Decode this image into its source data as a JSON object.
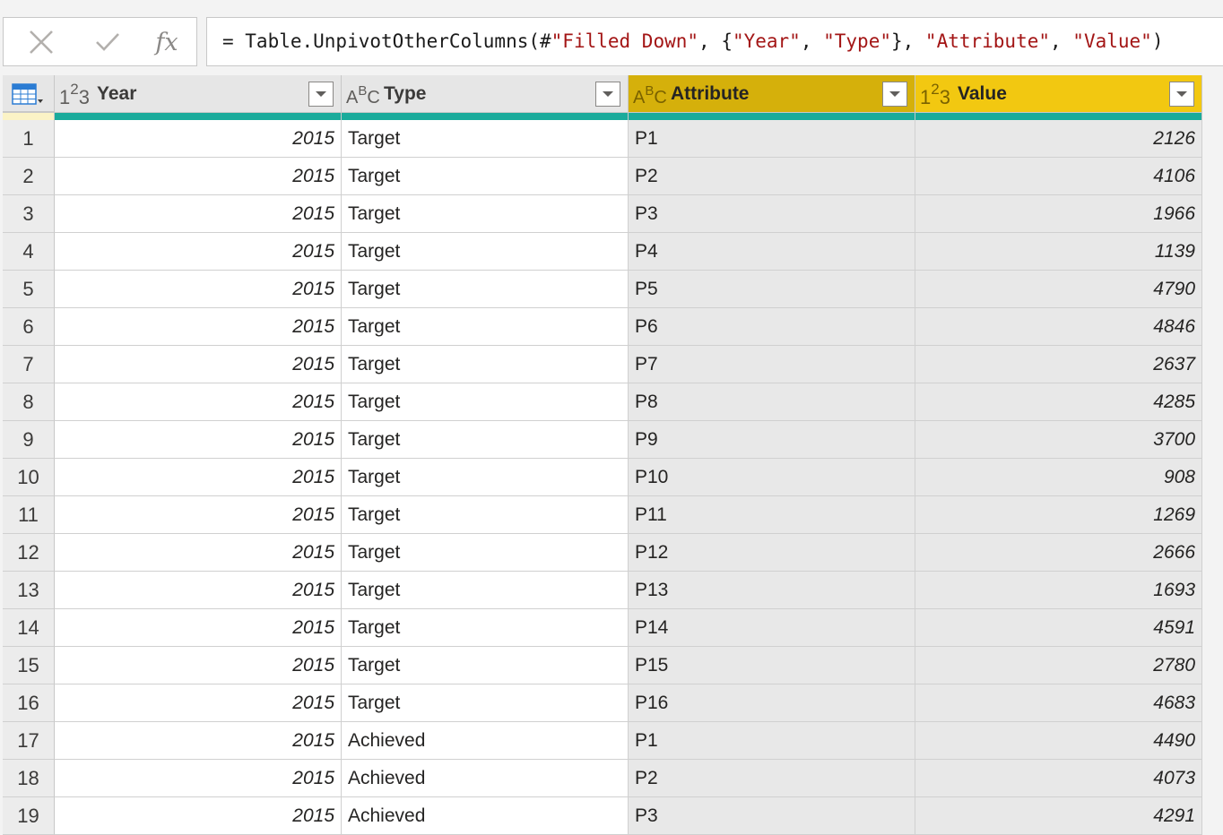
{
  "formula_bar": {
    "prefix": "= Table.UnpivotOtherColumns(#",
    "arg1": "\"Filled Down\"",
    "sep1": ", {",
    "arg2": "\"Year\"",
    "sep2": ", ",
    "arg3": "\"Type\"",
    "sep3": "}, ",
    "arg4": "\"Attribute\"",
    "sep4": ", ",
    "arg5": "\"Value\"",
    "suffix": ")",
    "cancel_icon": "close-icon",
    "commit_icon": "checkmark-icon",
    "fx_label": "fx"
  },
  "columns": [
    {
      "name": "Year",
      "type_icon": "123",
      "selected": false
    },
    {
      "name": "Type",
      "type_icon": "ABC",
      "selected": false
    },
    {
      "name": "Attribute",
      "type_icon": "ABC",
      "selected": true,
      "accent": "#d5b00b"
    },
    {
      "name": "Value",
      "type_icon": "123",
      "selected": true,
      "accent": "#f2c811"
    }
  ],
  "colors": {
    "column_quality": "#1aab9b",
    "selected_header_dark": "#d5b00b",
    "selected_header_light": "#f2c811",
    "formula_string": "#a31515"
  },
  "rows": [
    {
      "idx": "1",
      "year": "2015",
      "type": "Target",
      "attribute": "P1",
      "value": "2126"
    },
    {
      "idx": "2",
      "year": "2015",
      "type": "Target",
      "attribute": "P2",
      "value": "4106"
    },
    {
      "idx": "3",
      "year": "2015",
      "type": "Target",
      "attribute": "P3",
      "value": "1966"
    },
    {
      "idx": "4",
      "year": "2015",
      "type": "Target",
      "attribute": "P4",
      "value": "1139"
    },
    {
      "idx": "5",
      "year": "2015",
      "type": "Target",
      "attribute": "P5",
      "value": "4790"
    },
    {
      "idx": "6",
      "year": "2015",
      "type": "Target",
      "attribute": "P6",
      "value": "4846"
    },
    {
      "idx": "7",
      "year": "2015",
      "type": "Target",
      "attribute": "P7",
      "value": "2637"
    },
    {
      "idx": "8",
      "year": "2015",
      "type": "Target",
      "attribute": "P8",
      "value": "4285"
    },
    {
      "idx": "9",
      "year": "2015",
      "type": "Target",
      "attribute": "P9",
      "value": "3700"
    },
    {
      "idx": "10",
      "year": "2015",
      "type": "Target",
      "attribute": "P10",
      "value": "908"
    },
    {
      "idx": "11",
      "year": "2015",
      "type": "Target",
      "attribute": "P11",
      "value": "1269"
    },
    {
      "idx": "12",
      "year": "2015",
      "type": "Target",
      "attribute": "P12",
      "value": "2666"
    },
    {
      "idx": "13",
      "year": "2015",
      "type": "Target",
      "attribute": "P13",
      "value": "1693"
    },
    {
      "idx": "14",
      "year": "2015",
      "type": "Target",
      "attribute": "P14",
      "value": "4591"
    },
    {
      "idx": "15",
      "year": "2015",
      "type": "Target",
      "attribute": "P15",
      "value": "2780"
    },
    {
      "idx": "16",
      "year": "2015",
      "type": "Target",
      "attribute": "P16",
      "value": "4683"
    },
    {
      "idx": "17",
      "year": "2015",
      "type": "Achieved",
      "attribute": "P1",
      "value": "4490"
    },
    {
      "idx": "18",
      "year": "2015",
      "type": "Achieved",
      "attribute": "P2",
      "value": "4073"
    },
    {
      "idx": "19",
      "year": "2015",
      "type": "Achieved",
      "attribute": "P3",
      "value": "4291"
    }
  ]
}
